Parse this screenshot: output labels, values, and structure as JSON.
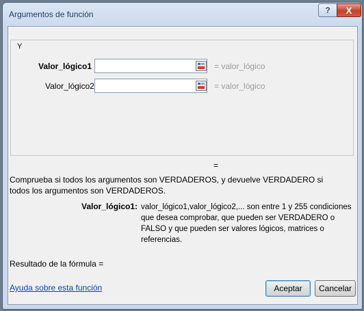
{
  "window": {
    "title": "Argumentos de función",
    "help_glyph": "?",
    "close_glyph": "X"
  },
  "function_group": {
    "name": "Y",
    "args": [
      {
        "label": "Valor_lógico1",
        "value": "",
        "eval": "=  valor_lógico",
        "bold": true
      },
      {
        "label": "Valor_lógico2",
        "value": "",
        "eval": "=  valor_lógico",
        "bold": false
      }
    ]
  },
  "result_equals": "=",
  "description": "Comprueba si todos los argumentos son VERDADEROS, y devuelve VERDADERO si todos los argumentos son VERDADEROS.",
  "param_help": {
    "name": "Valor_lógico1:",
    "text": "valor_lógico1,valor_lógico2,... son entre 1 y 255 condiciones que desea comprobar, que pueden ser VERDADERO o FALSO y que pueden ser valores lógicos, matrices o referencias."
  },
  "formula_result": "Resultado de la fórmula =",
  "help_link": "Ayuda sobre esta función",
  "buttons": {
    "ok": "Aceptar",
    "cancel": "Cancelar"
  },
  "icons": {
    "reference_button": "collapse-dialog-icon",
    "help": "help-icon",
    "close": "close-icon"
  }
}
